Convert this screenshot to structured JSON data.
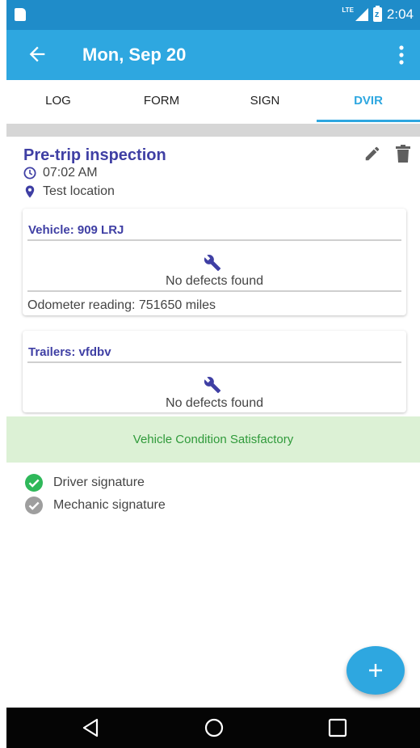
{
  "status_bar": {
    "network": "LTE",
    "time": "2:04",
    "battery_glyph": "z"
  },
  "app_bar": {
    "title": "Mon, Sep 20",
    "back_icon": "arrow-left-icon",
    "menu_icon": "more-vertical-icon"
  },
  "tabs": [
    {
      "label": "LOG",
      "active": false
    },
    {
      "label": "FORM",
      "active": false
    },
    {
      "label": "SIGN",
      "active": false
    },
    {
      "label": "DVIR",
      "active": true
    }
  ],
  "inspection": {
    "title": "Pre-trip inspection",
    "time": "07:02 AM",
    "location": "Test location"
  },
  "vehicle_card": {
    "title": "Vehicle: 909 LRJ",
    "defects": "No defects found",
    "odometer": "Odometer reading: 751650 miles"
  },
  "trailer_card": {
    "title": "Trailers: vfdbv",
    "defects": "No defects found"
  },
  "condition": {
    "text": "Vehicle Condition Satisfactory",
    "color": "#2f9a3a",
    "background": "#dcf1d5"
  },
  "signatures": [
    {
      "label": "Driver signature",
      "signed": true,
      "color": "#2fb85a"
    },
    {
      "label": "Mechanic signature",
      "signed": false,
      "color": "#9e9e9e"
    }
  ],
  "fab": {
    "icon": "plus-icon"
  },
  "colors": {
    "accent": "#2ea7e0",
    "status_bar": "#1f8cc9",
    "title_text": "#3f3fa4"
  }
}
